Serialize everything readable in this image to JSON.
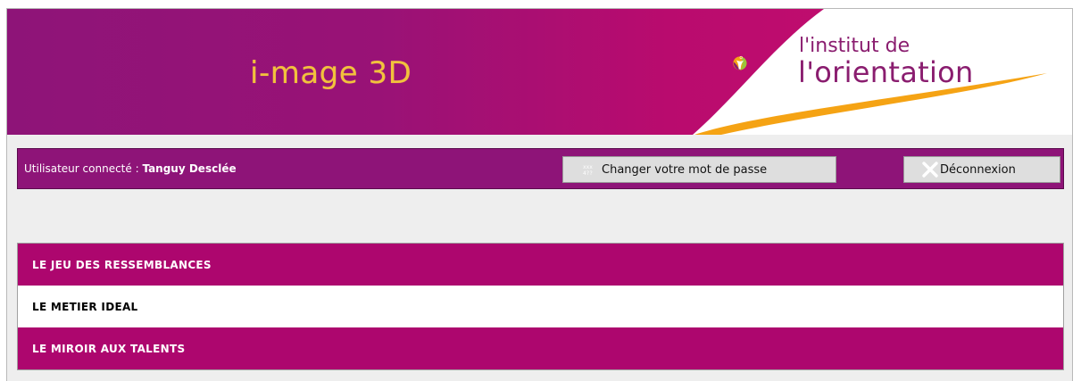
{
  "header": {
    "app_title": "i-mage 3D",
    "logo_line1": "l'institut de",
    "logo_line2": "l'orientation",
    "colors": {
      "banner": "#991276",
      "title_gold": "#f2c23c",
      "logo_purple": "#8a1d6f",
      "logo_orange": "#f5a314",
      "logo_green": "#9bc33a"
    }
  },
  "userbar": {
    "label": "Utilisateur connecté : ",
    "user_name": "Tanguy Desclée",
    "change_password_label": "Changer votre mot de passe",
    "change_password_icon": "keypad-icon",
    "logout_label": "Déconnexion",
    "logout_icon": "close-icon"
  },
  "menu": {
    "items": [
      {
        "label": "LE JEU DES RESSEMBLANCES",
        "style": "pink"
      },
      {
        "label": "LE METIER IDEAL",
        "style": "white"
      },
      {
        "label": "LE MIROIR AUX TALENTS",
        "style": "pink"
      }
    ],
    "colors": {
      "pink": "#ad066e",
      "white": "#ffffff"
    }
  }
}
